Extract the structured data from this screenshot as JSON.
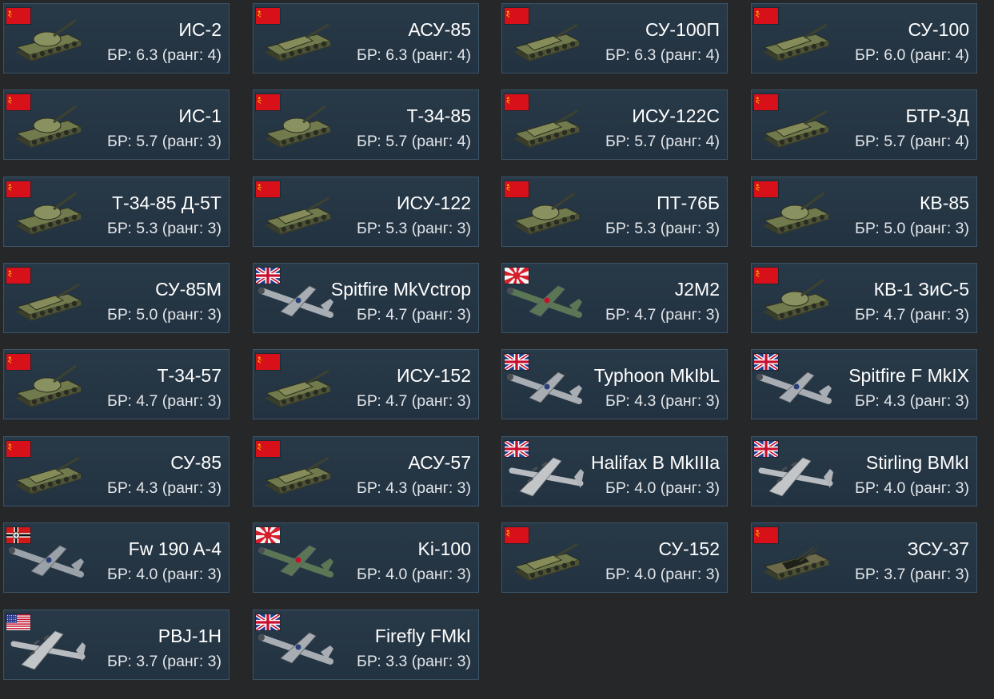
{
  "vehicles": [
    {
      "name": "ИС-2",
      "br": "БР: 6.3 (ранг: 4)",
      "nation": "ussr",
      "type": "tank",
      "flag_icon": "ussr-flag-icon",
      "thumb_icon": "tank-icon"
    },
    {
      "name": "АСУ-85",
      "br": "БР: 6.3 (ранг: 4)",
      "nation": "ussr",
      "type": "spg",
      "flag_icon": "ussr-flag-icon",
      "thumb_icon": "tank-destroyer-icon"
    },
    {
      "name": "СУ-100П",
      "br": "БР: 6.3 (ранг: 4)",
      "nation": "ussr",
      "type": "spg",
      "flag_icon": "ussr-flag-icon",
      "thumb_icon": "tank-destroyer-icon"
    },
    {
      "name": "СУ-100",
      "br": "БР: 6.0 (ранг: 4)",
      "nation": "ussr",
      "type": "spg",
      "flag_icon": "ussr-flag-icon",
      "thumb_icon": "tank-destroyer-icon"
    },
    {
      "name": "ИС-1",
      "br": "БР: 5.7 (ранг: 3)",
      "nation": "ussr",
      "type": "tank",
      "flag_icon": "ussr-flag-icon",
      "thumb_icon": "tank-icon"
    },
    {
      "name": "Т-34-85",
      "br": "БР: 5.7 (ранг: 4)",
      "nation": "ussr",
      "type": "tank",
      "flag_icon": "ussr-flag-icon",
      "thumb_icon": "tank-icon"
    },
    {
      "name": "ИСУ-122С",
      "br": "БР: 5.7 (ранг: 4)",
      "nation": "ussr",
      "type": "spg",
      "flag_icon": "ussr-flag-icon",
      "thumb_icon": "tank-destroyer-icon"
    },
    {
      "name": "БТР-3Д",
      "br": "БР: 5.7 (ранг: 4)",
      "nation": "ussr",
      "type": "spg",
      "flag_icon": "ussr-flag-icon",
      "thumb_icon": "apc-icon"
    },
    {
      "name": "Т-34-85 Д-5Т",
      "br": "БР: 5.3 (ранг: 3)",
      "nation": "ussr",
      "type": "tank",
      "flag_icon": "ussr-flag-icon",
      "thumb_icon": "tank-icon"
    },
    {
      "name": "ИСУ-122",
      "br": "БР: 5.3 (ранг: 3)",
      "nation": "ussr",
      "type": "spg",
      "flag_icon": "ussr-flag-icon",
      "thumb_icon": "tank-destroyer-icon"
    },
    {
      "name": "ПТ-76Б",
      "br": "БР: 5.3 (ранг: 3)",
      "nation": "ussr",
      "type": "tank",
      "flag_icon": "ussr-flag-icon",
      "thumb_icon": "tank-icon"
    },
    {
      "name": "КВ-85",
      "br": "БР: 5.0 (ранг: 3)",
      "nation": "ussr",
      "type": "tank",
      "flag_icon": "ussr-flag-icon",
      "thumb_icon": "tank-icon"
    },
    {
      "name": "СУ-85М",
      "br": "БР: 5.0 (ранг: 3)",
      "nation": "ussr",
      "type": "spg",
      "flag_icon": "ussr-flag-icon",
      "thumb_icon": "tank-destroyer-icon"
    },
    {
      "name": "Spitfire MkVctrop",
      "br": "БР: 4.7 (ранг: 3)",
      "nation": "uk",
      "type": "plane",
      "flag_icon": "uk-flag-icon",
      "thumb_icon": "fighter-plane-icon"
    },
    {
      "name": "J2M2",
      "br": "БР: 4.7 (ранг: 3)",
      "nation": "japan",
      "type": "plane",
      "flag_icon": "japan-flag-icon",
      "thumb_icon": "fighter-plane-icon"
    },
    {
      "name": "КВ-1 ЗиС-5",
      "br": "БР: 4.7 (ранг: 3)",
      "nation": "ussr",
      "type": "tank",
      "flag_icon": "ussr-flag-icon",
      "thumb_icon": "tank-icon"
    },
    {
      "name": "Т-34-57",
      "br": "БР: 4.7 (ранг: 3)",
      "nation": "ussr",
      "type": "tank",
      "flag_icon": "ussr-flag-icon",
      "thumb_icon": "tank-icon"
    },
    {
      "name": "ИСУ-152",
      "br": "БР: 4.7 (ранг: 3)",
      "nation": "ussr",
      "type": "spg",
      "flag_icon": "ussr-flag-icon",
      "thumb_icon": "tank-destroyer-icon"
    },
    {
      "name": "Typhoon MkIbL",
      "br": "БР: 4.3 (ранг: 3)",
      "nation": "uk",
      "type": "plane",
      "flag_icon": "uk-flag-icon",
      "thumb_icon": "fighter-plane-icon"
    },
    {
      "name": "Spitfire F MkIX",
      "br": "БР: 4.3 (ранг: 3)",
      "nation": "uk",
      "type": "plane",
      "flag_icon": "uk-flag-icon",
      "thumb_icon": "fighter-plane-icon"
    },
    {
      "name": "СУ-85",
      "br": "БР: 4.3 (ранг: 3)",
      "nation": "ussr",
      "type": "spg",
      "flag_icon": "ussr-flag-icon",
      "thumb_icon": "tank-destroyer-icon"
    },
    {
      "name": "АСУ-57",
      "br": "БР: 4.3 (ранг: 3)",
      "nation": "ussr",
      "type": "spg",
      "flag_icon": "ussr-flag-icon",
      "thumb_icon": "tank-destroyer-icon"
    },
    {
      "name": "Halifax B MkIIIa",
      "br": "БР: 4.0 (ранг: 3)",
      "nation": "uk",
      "type": "bomber",
      "flag_icon": "uk-flag-icon",
      "thumb_icon": "bomber-plane-icon"
    },
    {
      "name": "Stirling BMkI",
      "br": "БР: 4.0 (ранг: 3)",
      "nation": "uk",
      "type": "bomber",
      "flag_icon": "uk-flag-icon",
      "thumb_icon": "bomber-plane-icon"
    },
    {
      "name": "Fw 190 A-4",
      "br": "БР: 4.0 (ранг: 3)",
      "nation": "germany",
      "type": "plane",
      "flag_icon": "germany-flag-icon",
      "thumb_icon": "fighter-plane-icon"
    },
    {
      "name": "Ki-100",
      "br": "БР: 4.0 (ранг: 3)",
      "nation": "japan",
      "type": "plane",
      "flag_icon": "japan-flag-icon",
      "thumb_icon": "fighter-plane-icon"
    },
    {
      "name": "СУ-152",
      "br": "БР: 4.0 (ранг: 3)",
      "nation": "ussr",
      "type": "spg",
      "flag_icon": "ussr-flag-icon",
      "thumb_icon": "tank-destroyer-icon"
    },
    {
      "name": "ЗСУ-37",
      "br": "БР: 3.7 (ранг: 3)",
      "nation": "ussr",
      "type": "spaa",
      "flag_icon": "ussr-flag-icon",
      "thumb_icon": "anti-aircraft-vehicle-icon"
    },
    {
      "name": "PBJ-1H",
      "br": "БР: 3.7 (ранг: 3)",
      "nation": "usa",
      "type": "bomber",
      "flag_icon": "usa-flag-icon",
      "thumb_icon": "bomber-plane-icon"
    },
    {
      "name": "Firefly FMkI",
      "br": "БР: 3.3 (ранг: 3)",
      "nation": "uk",
      "type": "plane",
      "flag_icon": "uk-flag-icon",
      "thumb_icon": "fighter-plane-icon"
    }
  ],
  "colors": {
    "page_bg": "#262729",
    "card_bg": "#253646",
    "card_border": "#3b5468",
    "name_text": "#ffffff",
    "br_text": "#e3e6ea",
    "ussr_red": "#d8101a",
    "uk_blue": "#1f3d8a",
    "japan_red": "#d81e2c",
    "usa_blue": "#2d3a8c",
    "germany_red": "#d01818"
  }
}
